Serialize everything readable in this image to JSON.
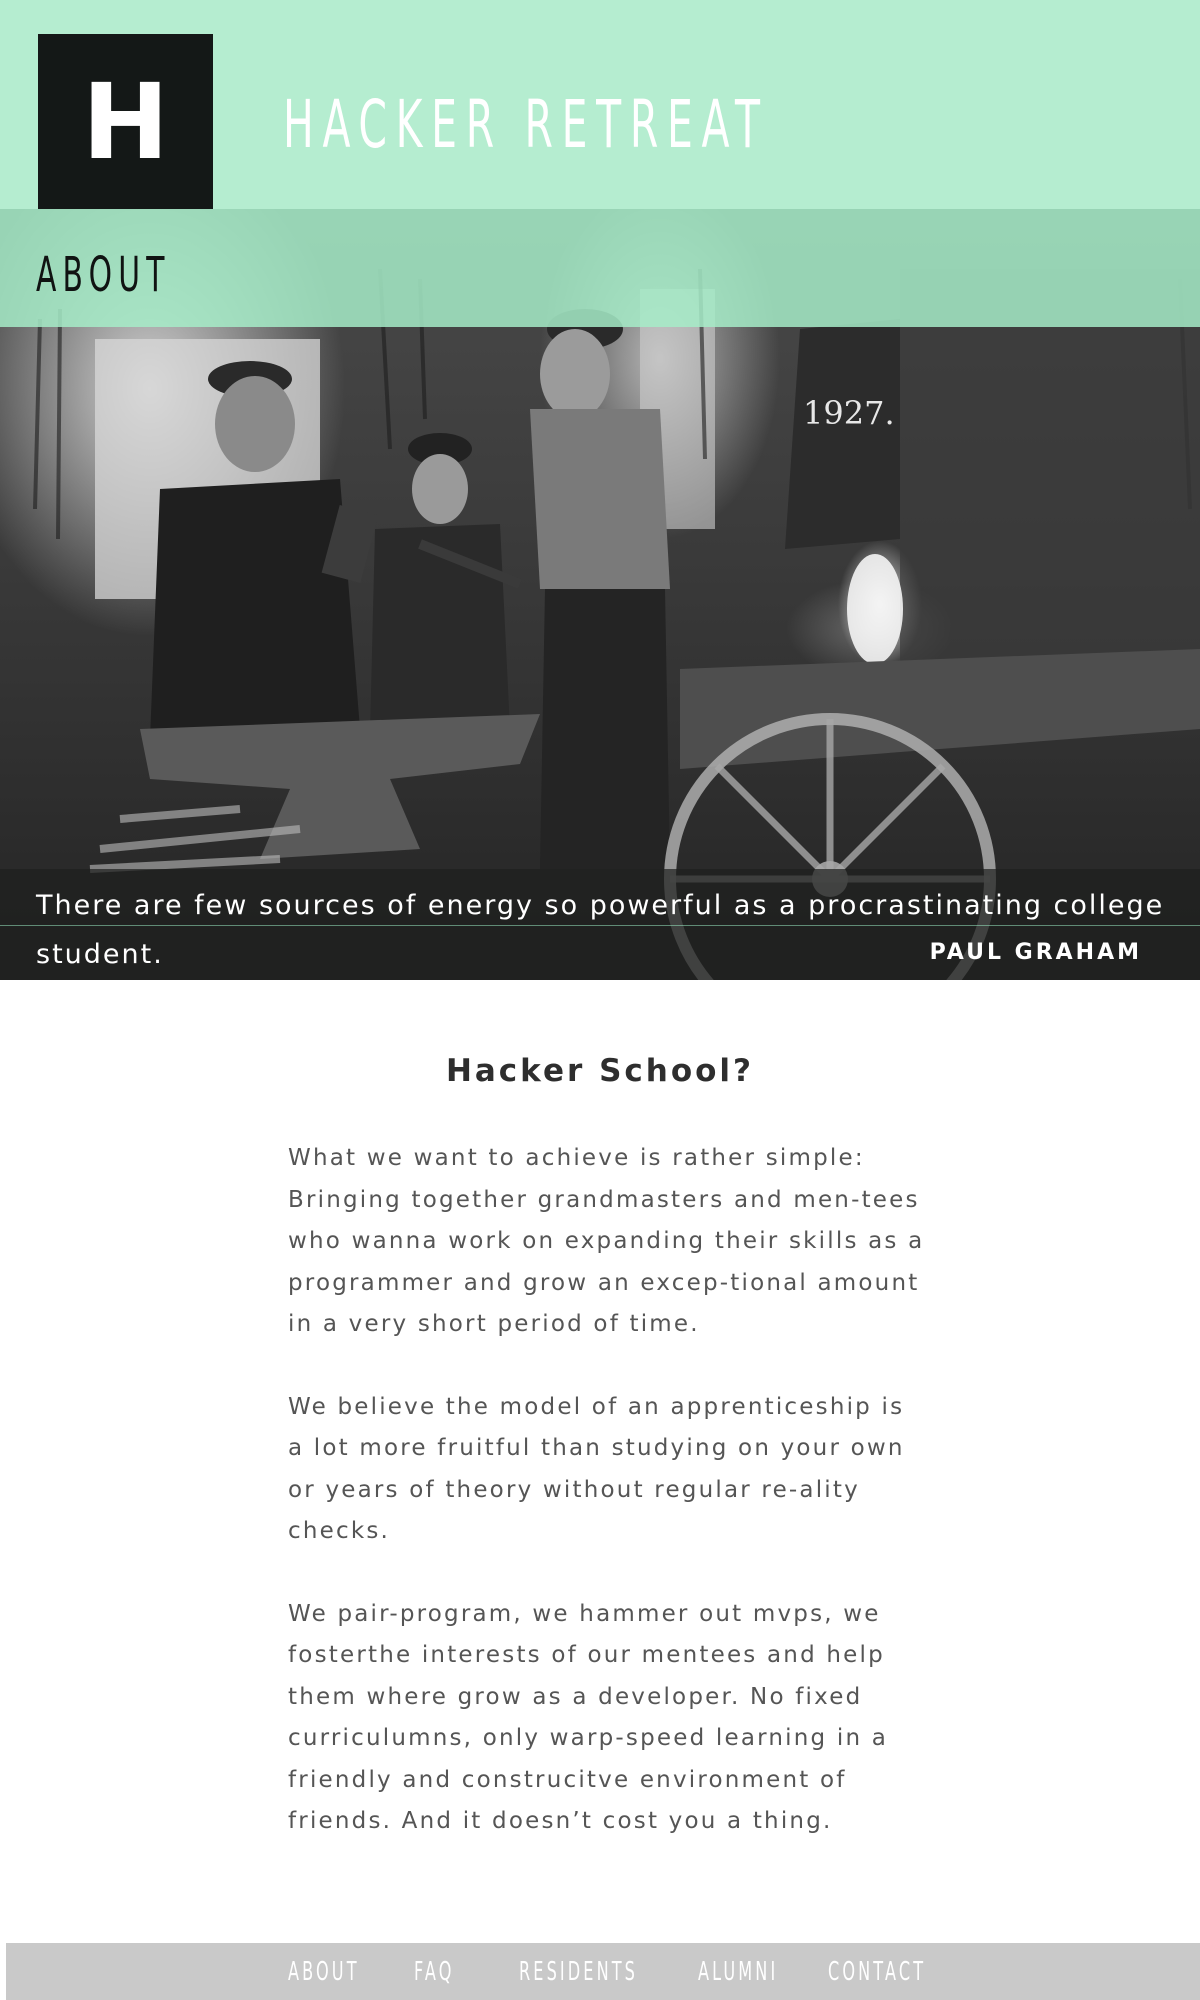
{
  "header": {
    "logo_letter": "H",
    "site_title": "HACKER RETREAT"
  },
  "hero": {
    "section_title": "ABOUT",
    "quote": "There are few sources of energy so powerful as a procrastinating college student.",
    "quote_author": "PAUL GRAHAM",
    "photo_year_marking": "1927."
  },
  "main": {
    "heading": "Hacker School?",
    "paragraphs": [
      "What we want to achieve is rather simple: Bringing together grandmasters and men-tees who wanna work on expanding their skills as a programmer and grow an excep-tional amount in a very short period of time.",
      "We believe the model of an apprenticeship is a lot more fruitful than studying on your own or years of theory without regular re-ality checks.",
      "We pair-program, we hammer out mvps, we fosterthe interests of our mentees and help them where grow as a developer. No fixed curriculumns, only warp-speed learning in a friendly and construcitve environment of friends. And it doesn’t cost you a thing."
    ]
  },
  "footer_nav": {
    "items": [
      {
        "label": "ABOUT"
      },
      {
        "label": "FAQ"
      },
      {
        "label": "RESIDENTS"
      },
      {
        "label": "ALUMNI"
      },
      {
        "label": "CONTACT"
      }
    ]
  },
  "colors": {
    "mint": "#b5edd0",
    "logo_bg": "#141817",
    "footer_bg": "#c9c9c9",
    "body_text": "#555555"
  }
}
